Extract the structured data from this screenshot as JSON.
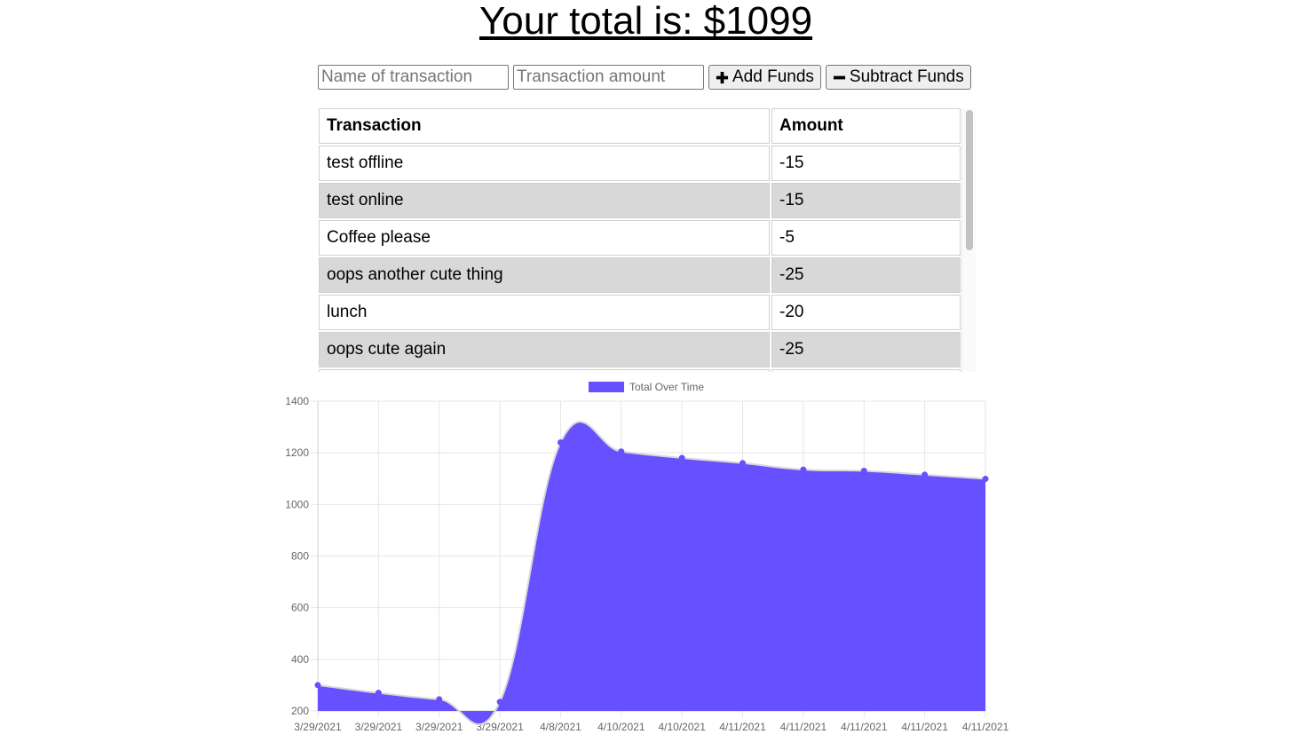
{
  "header": {
    "total_text": "Your total is: $1099"
  },
  "form": {
    "name_placeholder": "Name of transaction",
    "amount_placeholder": "Transaction amount",
    "add_label": "Add Funds",
    "subtract_label": "Subtract Funds",
    "add_icon": "plus-icon",
    "subtract_icon": "minus-icon"
  },
  "table": {
    "headers": [
      "Transaction",
      "Amount"
    ],
    "rows": [
      [
        "test offline",
        "-15"
      ],
      [
        "test online",
        "-15"
      ],
      [
        "Coffee please",
        "-5"
      ],
      [
        "oops another cute thing",
        "-25"
      ],
      [
        "lunch",
        "-20"
      ],
      [
        "oops cute again",
        "-25"
      ],
      [
        "",
        ""
      ]
    ]
  },
  "colors": {
    "chart_fill": "#6650ff",
    "chart_line": "#d8d8d8",
    "row_alt": "#d8d8d8"
  },
  "chart_data": {
    "type": "area",
    "legend": "Total Over Time",
    "legend_position": "top",
    "categories": [
      "3/29/2021",
      "3/29/2021",
      "3/29/2021",
      "3/29/2021",
      "4/8/2021",
      "4/10/2021",
      "4/10/2021",
      "4/11/2021",
      "4/11/2021",
      "4/11/2021",
      "4/11/2021",
      "4/11/2021"
    ],
    "series": [
      {
        "name": "Total Over Time",
        "values": [
          300,
          270,
          245,
          235,
          1240,
          1205,
          1180,
          1160,
          1135,
          1130,
          1115,
          1099
        ]
      }
    ],
    "ylim": [
      200,
      1400
    ],
    "yticks": [
      200,
      400,
      600,
      800,
      1000,
      1200,
      1400
    ],
    "grid": true
  }
}
